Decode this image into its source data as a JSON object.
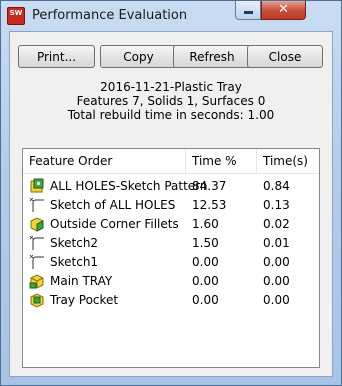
{
  "window": {
    "title": "Performance Evaluation",
    "app_icon_text": "SW",
    "close_glyph": "✕"
  },
  "toolbar": {
    "print_label": "Print...",
    "copy_label": "Copy",
    "refresh_label": "Refresh",
    "close_label": "Close"
  },
  "summary": {
    "file_name": "2016-11-21-Plastic Tray",
    "counts": "Features 7, Solids 1, Surfaces 0",
    "rebuild_time": "Total rebuild time in seconds: 1.00"
  },
  "table": {
    "columns": [
      "Feature Order",
      "Time %",
      "Time(s)"
    ],
    "rows": [
      {
        "feature": "ALL HOLES-Sketch Pattern",
        "pct": "84.37",
        "secs": "0.84",
        "icon": "sketch-pattern-icon"
      },
      {
        "feature": "Sketch of ALL HOLES",
        "pct": "12.53",
        "secs": "0.13",
        "icon": "sketch-icon"
      },
      {
        "feature": "Outside Corner Fillets",
        "pct": "1.60",
        "secs": "0.02",
        "icon": "fillet-icon"
      },
      {
        "feature": "Sketch2",
        "pct": "1.50",
        "secs": "0.01",
        "icon": "sketch-icon"
      },
      {
        "feature": "Sketch1",
        "pct": "0.00",
        "secs": "0.00",
        "icon": "sketch-icon"
      },
      {
        "feature": "Main TRAY",
        "pct": "0.00",
        "secs": "0.00",
        "icon": "extrude-icon"
      },
      {
        "feature": "Tray Pocket",
        "pct": "0.00",
        "secs": "0.00",
        "icon": "cut-icon"
      }
    ]
  },
  "colors": {
    "title_bar": "#b6cde9",
    "close_button": "#c9503b",
    "feature_yellow": "#f2d23c",
    "feature_green": "#3aa63a"
  }
}
